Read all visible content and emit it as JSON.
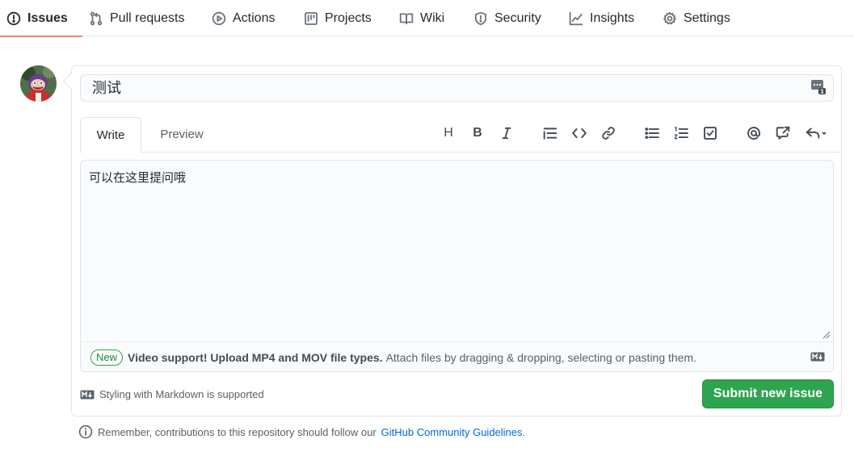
{
  "nav": {
    "tabs": [
      {
        "label": "Issues",
        "icon": "issue-opened-icon",
        "selected": true
      },
      {
        "label": "Pull requests",
        "icon": "git-pull-request-icon"
      },
      {
        "label": "Actions",
        "icon": "play-icon"
      },
      {
        "label": "Projects",
        "icon": "project-icon"
      },
      {
        "label": "Wiki",
        "icon": "book-icon"
      },
      {
        "label": "Security",
        "icon": "shield-icon"
      },
      {
        "label": "Insights",
        "icon": "graph-icon"
      },
      {
        "label": "Settings",
        "icon": "gear-icon"
      }
    ]
  },
  "issue_form": {
    "title_value": "测试",
    "tabs": {
      "write": "Write",
      "preview": "Preview"
    },
    "toolbar": [
      {
        "name": "heading-icon",
        "glyph": "H"
      },
      {
        "name": "bold-icon",
        "glyph": "B"
      },
      {
        "name": "italic-icon"
      },
      {
        "name": "quote-icon"
      },
      {
        "name": "code-icon"
      },
      {
        "name": "link-icon"
      },
      {
        "name": "unordered-list-icon"
      },
      {
        "name": "ordered-list-icon"
      },
      {
        "name": "task-list-icon"
      },
      {
        "name": "mention-icon"
      },
      {
        "name": "cross-reference-icon"
      },
      {
        "name": "reply-icon"
      }
    ],
    "body_value": "可以在这里提问哦",
    "drop_bar": {
      "badge": "New",
      "strong": "Video support! Upload MP4 and MOV file types.",
      "text": "Attach files by dragging & dropping, selecting or pasting them."
    },
    "markdown_note": "Styling with Markdown is supported",
    "submit_label": "Submit new issue"
  },
  "footer": {
    "prefix": "Remember, contributions to this repository should follow our",
    "link": "GitHub Community Guidelines",
    "suffix": "."
  },
  "colors": {
    "accent_underline": "#f9826c",
    "submit_green": "#2ea44f",
    "new_badge_green": "#22863a",
    "link_blue": "#0366d6"
  }
}
